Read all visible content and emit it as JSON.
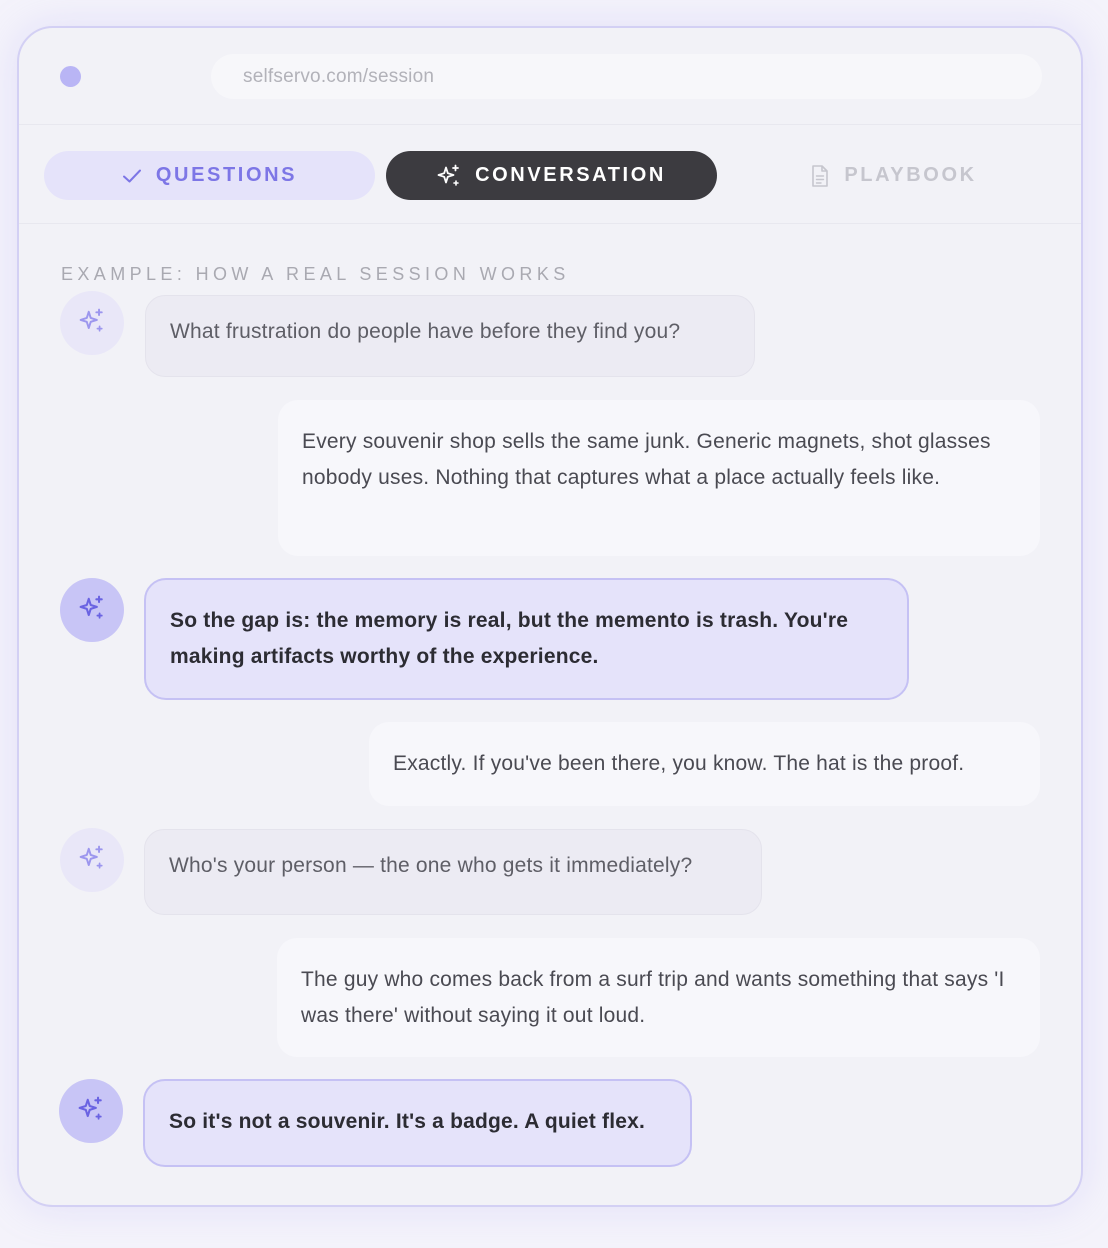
{
  "browser": {
    "url": "selfservo.com/session"
  },
  "tabs": [
    {
      "label": "QUESTIONS",
      "icon": "check-icon",
      "state": "done"
    },
    {
      "label": "CONVERSATION",
      "icon": "sparkle-icon",
      "state": "active"
    },
    {
      "label": "PLAYBOOK",
      "icon": "document-icon",
      "state": "inactive"
    }
  ],
  "section_label": "EXAMPLE: HOW A REAL SESSION WORKS",
  "messages": [
    {
      "role": "assistant",
      "style": "plain",
      "text": "What frustration do people have before they find you?"
    },
    {
      "role": "user",
      "text": "Every souvenir shop sells the same junk. Generic magnets, shot glasses nobody uses. Nothing that captures what a place actually feels like."
    },
    {
      "role": "assistant",
      "style": "highlight",
      "text": "So the gap is: the memory is real, but the memento is trash. You're making artifacts worthy of the experience."
    },
    {
      "role": "user",
      "text": "Exactly. If you've been there, you know. The hat is the proof."
    },
    {
      "role": "assistant",
      "style": "plain",
      "text": "Who's your person — the one who gets it immediately?"
    },
    {
      "role": "user",
      "text": "The guy who comes back from a surf trip and wants something that says 'I was there' without saying it out loud."
    },
    {
      "role": "assistant",
      "style": "highlight",
      "text": "So it's not a souvenir. It's a badge. A quiet flex."
    }
  ],
  "colors": {
    "accent": "#7d76e6",
    "active_tab": "#3c3b40",
    "highlight_bubble": "#e5e3fa"
  }
}
